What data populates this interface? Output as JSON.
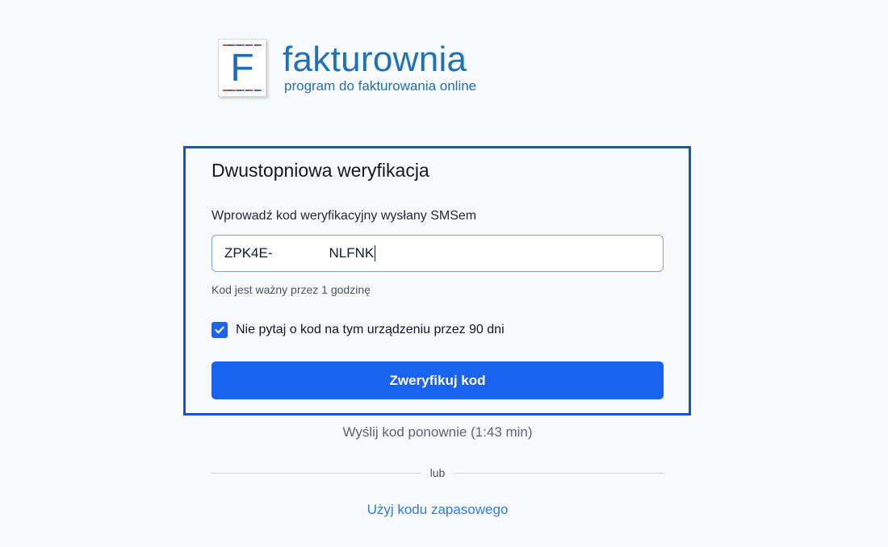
{
  "logo": {
    "letter": "F",
    "name": "fakturownia",
    "tagline": "program do fakturowania online"
  },
  "verification": {
    "title": "Dwustopniowa weryfikacja",
    "field_label": "Wprowadź kod weryfikacyjny wysłany SMSem",
    "code_prefix": "ZPK4E-",
    "code_suffix": "NLFNK",
    "hint": "Kod jest ważny przez 1 godzinę",
    "remember_label": "Nie pytaj o kod na tym urządzeniu przez 90 dni",
    "remember_checked": true,
    "submit_label": "Zweryfikuj kod"
  },
  "resend_label": "Wyślij kod ponownie (1:43 min)",
  "divider_label": "lub",
  "backup_link_label": "Użyj kodu zapasowego",
  "colors": {
    "primary": "#1a63f0",
    "brand": "#1f72b8",
    "link": "#2f7de1",
    "highlight_border": "#1552c9"
  }
}
